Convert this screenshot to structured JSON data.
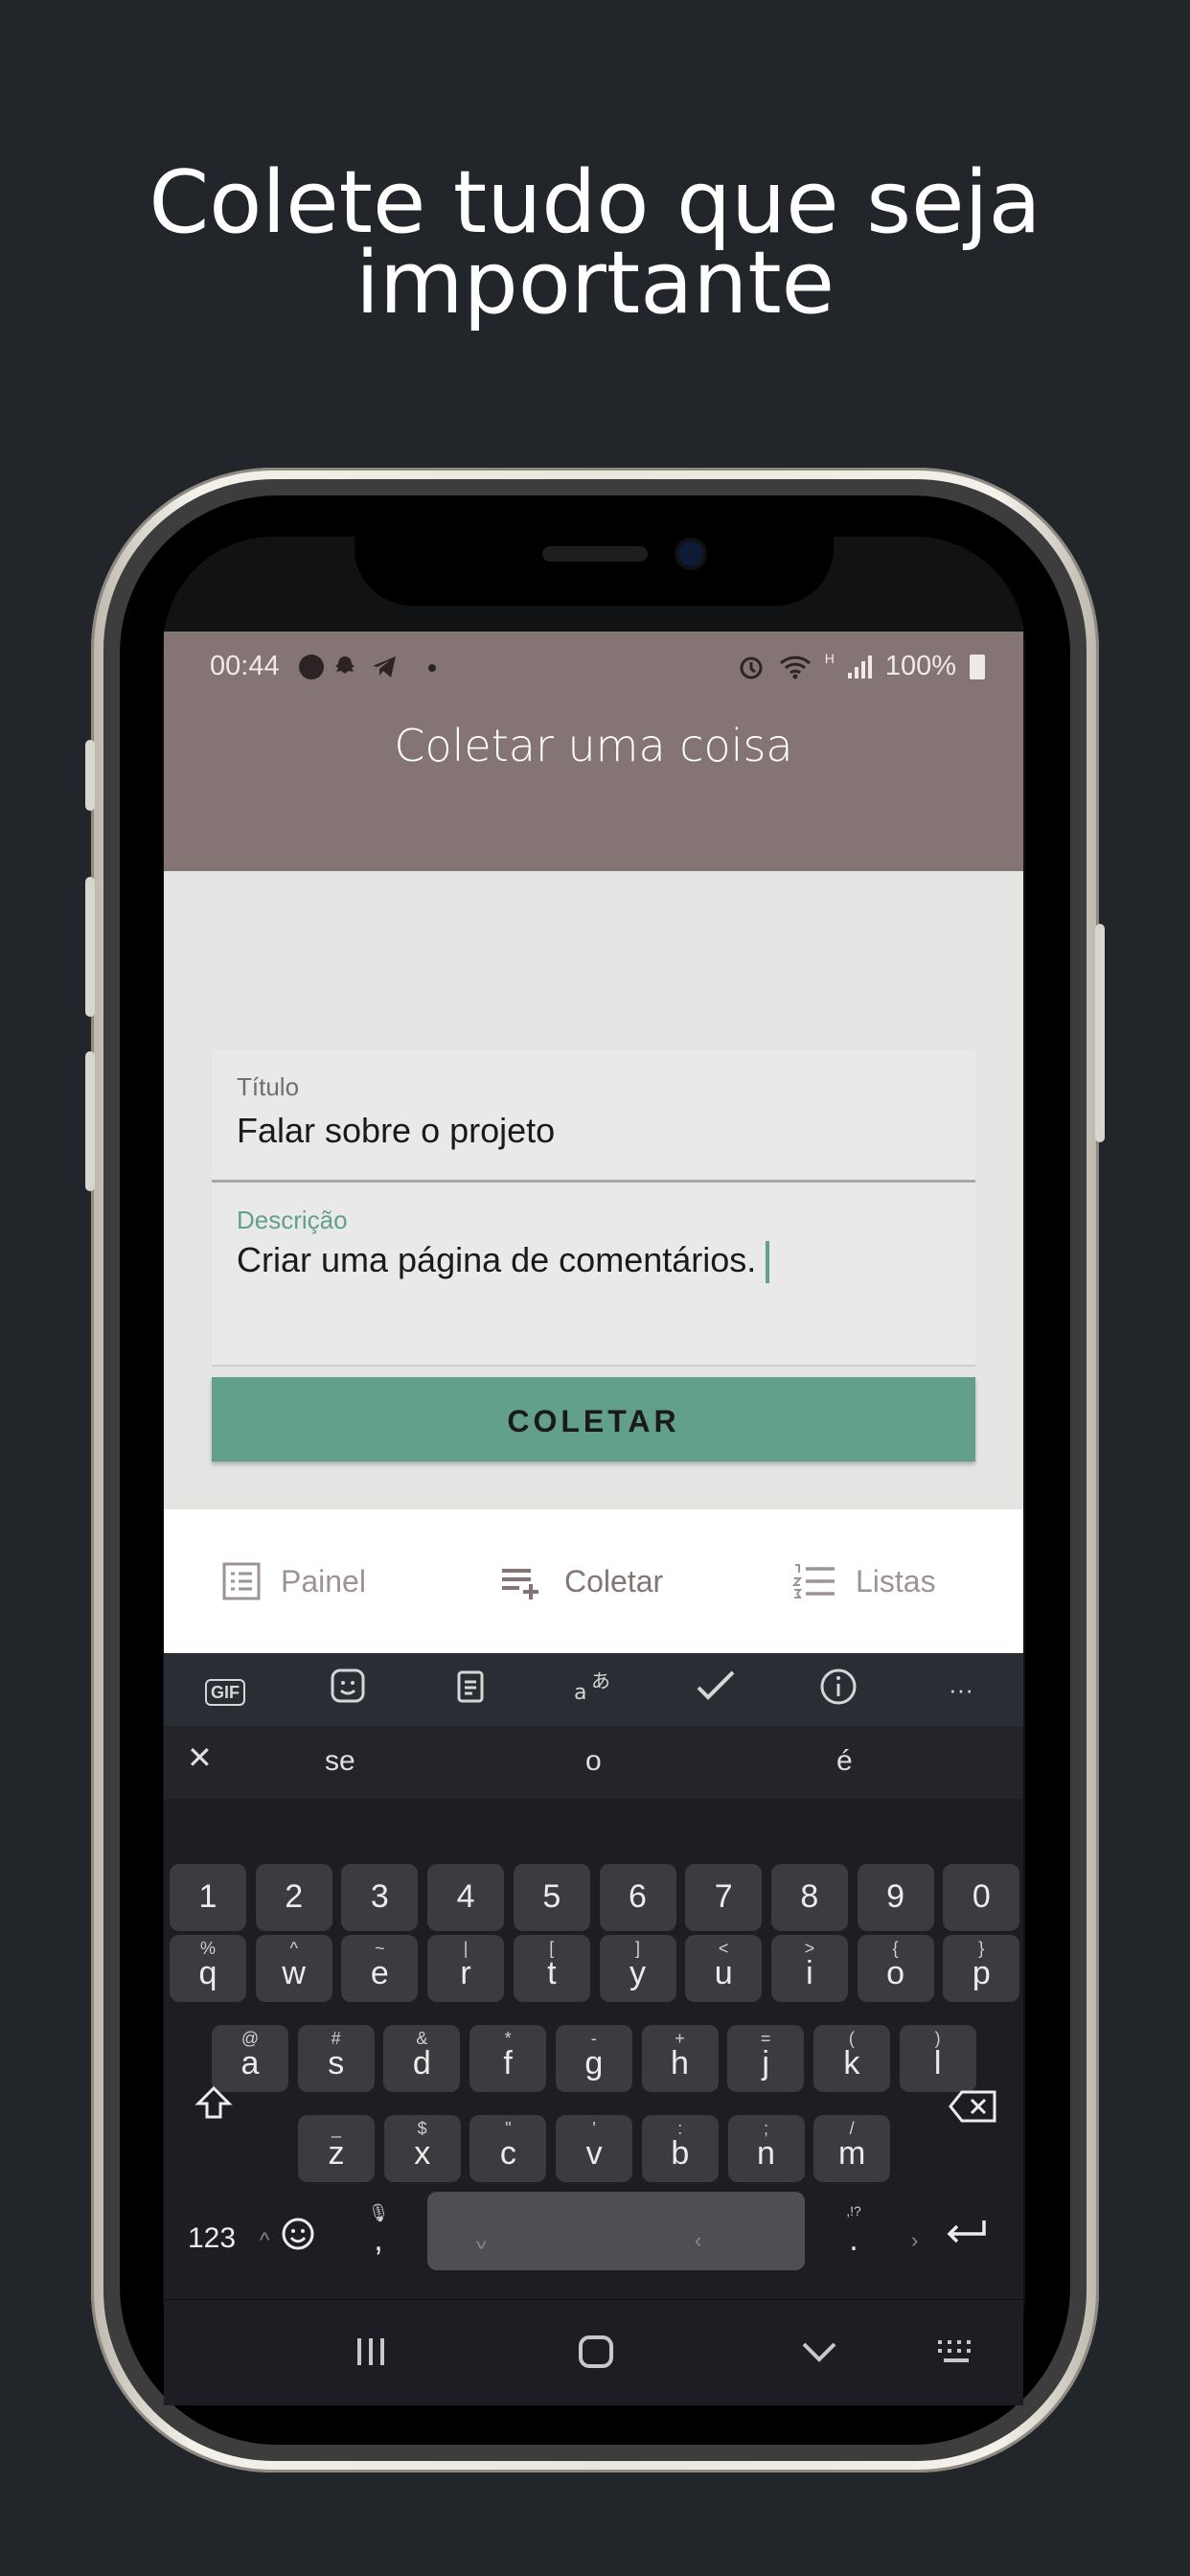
{
  "headline": {
    "line1": "Colete tudo que seja",
    "line2": "importante"
  },
  "status_bar": {
    "time": "00:44",
    "hd": "H",
    "battery": "100%"
  },
  "app": {
    "title": "Coletar uma coisa",
    "form": {
      "title_label": "Título",
      "title_value": "Falar sobre o projeto",
      "description_label": "Descrição",
      "description_value": "Criar uma página de comentários."
    },
    "submit_label": "COLETAR",
    "accent_color": "#63a08c",
    "bar_color": "#857474",
    "bottom_nav": [
      {
        "label": "Painel",
        "icon": "dashboard-icon"
      },
      {
        "label": "Coletar",
        "icon": "playlist-add-icon"
      },
      {
        "label": "Listas",
        "icon": "list-numbered-icon"
      }
    ]
  },
  "keyboard": {
    "toolbar": [
      "GIF",
      "sticker-icon",
      "clipboard-icon",
      "translate-icon",
      "spellcheck-icon",
      "info-icon",
      "more-icon"
    ],
    "suggestions": [
      "se",
      "o",
      "é"
    ],
    "numbers": [
      "1",
      "2",
      "3",
      "4",
      "5",
      "6",
      "7",
      "8",
      "9",
      "0"
    ],
    "row1": [
      {
        "k": "q",
        "a": "%"
      },
      {
        "k": "w",
        "a": "^"
      },
      {
        "k": "e",
        "a": "~"
      },
      {
        "k": "r",
        "a": "|"
      },
      {
        "k": "t",
        "a": "["
      },
      {
        "k": "y",
        "a": "]"
      },
      {
        "k": "u",
        "a": "<"
      },
      {
        "k": "i",
        "a": ">"
      },
      {
        "k": "o",
        "a": "{"
      },
      {
        "k": "p",
        "a": "}"
      }
    ],
    "row2": [
      {
        "k": "a",
        "a": "@"
      },
      {
        "k": "s",
        "a": "#"
      },
      {
        "k": "d",
        "a": "&"
      },
      {
        "k": "f",
        "a": "*"
      },
      {
        "k": "g",
        "a": "-"
      },
      {
        "k": "h",
        "a": "+"
      },
      {
        "k": "j",
        "a": "="
      },
      {
        "k": "k",
        "a": "("
      },
      {
        "k": "l",
        "a": ")"
      }
    ],
    "row3": [
      {
        "k": "z",
        "a": "_"
      },
      {
        "k": "x",
        "a": "$"
      },
      {
        "k": "c",
        "a": "\""
      },
      {
        "k": "v",
        "a": "'"
      },
      {
        "k": "b",
        "a": ":"
      },
      {
        "k": "n",
        "a": ";"
      },
      {
        "k": "m",
        "a": "/"
      }
    ],
    "numeric_switch": "123",
    "comma": ",",
    "period": ".",
    "period_alt": ",!?"
  }
}
